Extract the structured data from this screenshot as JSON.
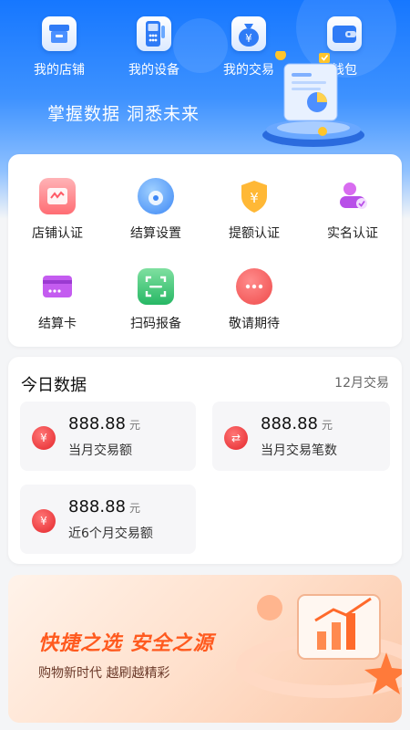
{
  "top_nav": [
    {
      "label": "我的店铺",
      "icon": "store-icon"
    },
    {
      "label": "我的设备",
      "icon": "pos-device-icon"
    },
    {
      "label": "我的交易",
      "icon": "money-bag-icon"
    },
    {
      "label": "钱包",
      "icon": "wallet-icon"
    }
  ],
  "slogan": "掌握数据 洞悉未来",
  "services": [
    {
      "label": "店铺认证",
      "icon": "store-cert-icon"
    },
    {
      "label": "结算设置",
      "icon": "settlement-setting-icon"
    },
    {
      "label": "提额认证",
      "icon": "shield-yen-icon"
    },
    {
      "label": "实名认证",
      "icon": "realname-icon"
    },
    {
      "label": "结算卡",
      "icon": "card-icon"
    },
    {
      "label": "扫码报备",
      "icon": "scan-icon"
    },
    {
      "label": "敬请期待",
      "icon": "more-icon"
    }
  ],
  "today": {
    "title": "今日数据",
    "month_label": "12月交易",
    "stats": [
      {
        "value": "888.88",
        "unit": "元",
        "label": "当月交易额",
        "icon": "yen-bag-icon"
      },
      {
        "value": "888.88",
        "unit": "元",
        "label": "当月交易笔数",
        "icon": "exchange-icon"
      },
      {
        "value": "888.88",
        "unit": "元",
        "label": "近6个月交易额",
        "icon": "yen-bag-icon"
      }
    ]
  },
  "banner": {
    "title": "快捷之选 安全之源",
    "subtitle": "购物新时代 越刷越精彩"
  },
  "colors": {
    "brand_blue": "#1677ff",
    "accent_red": "#e4262b",
    "banner_orange": "#ff5a1f"
  }
}
